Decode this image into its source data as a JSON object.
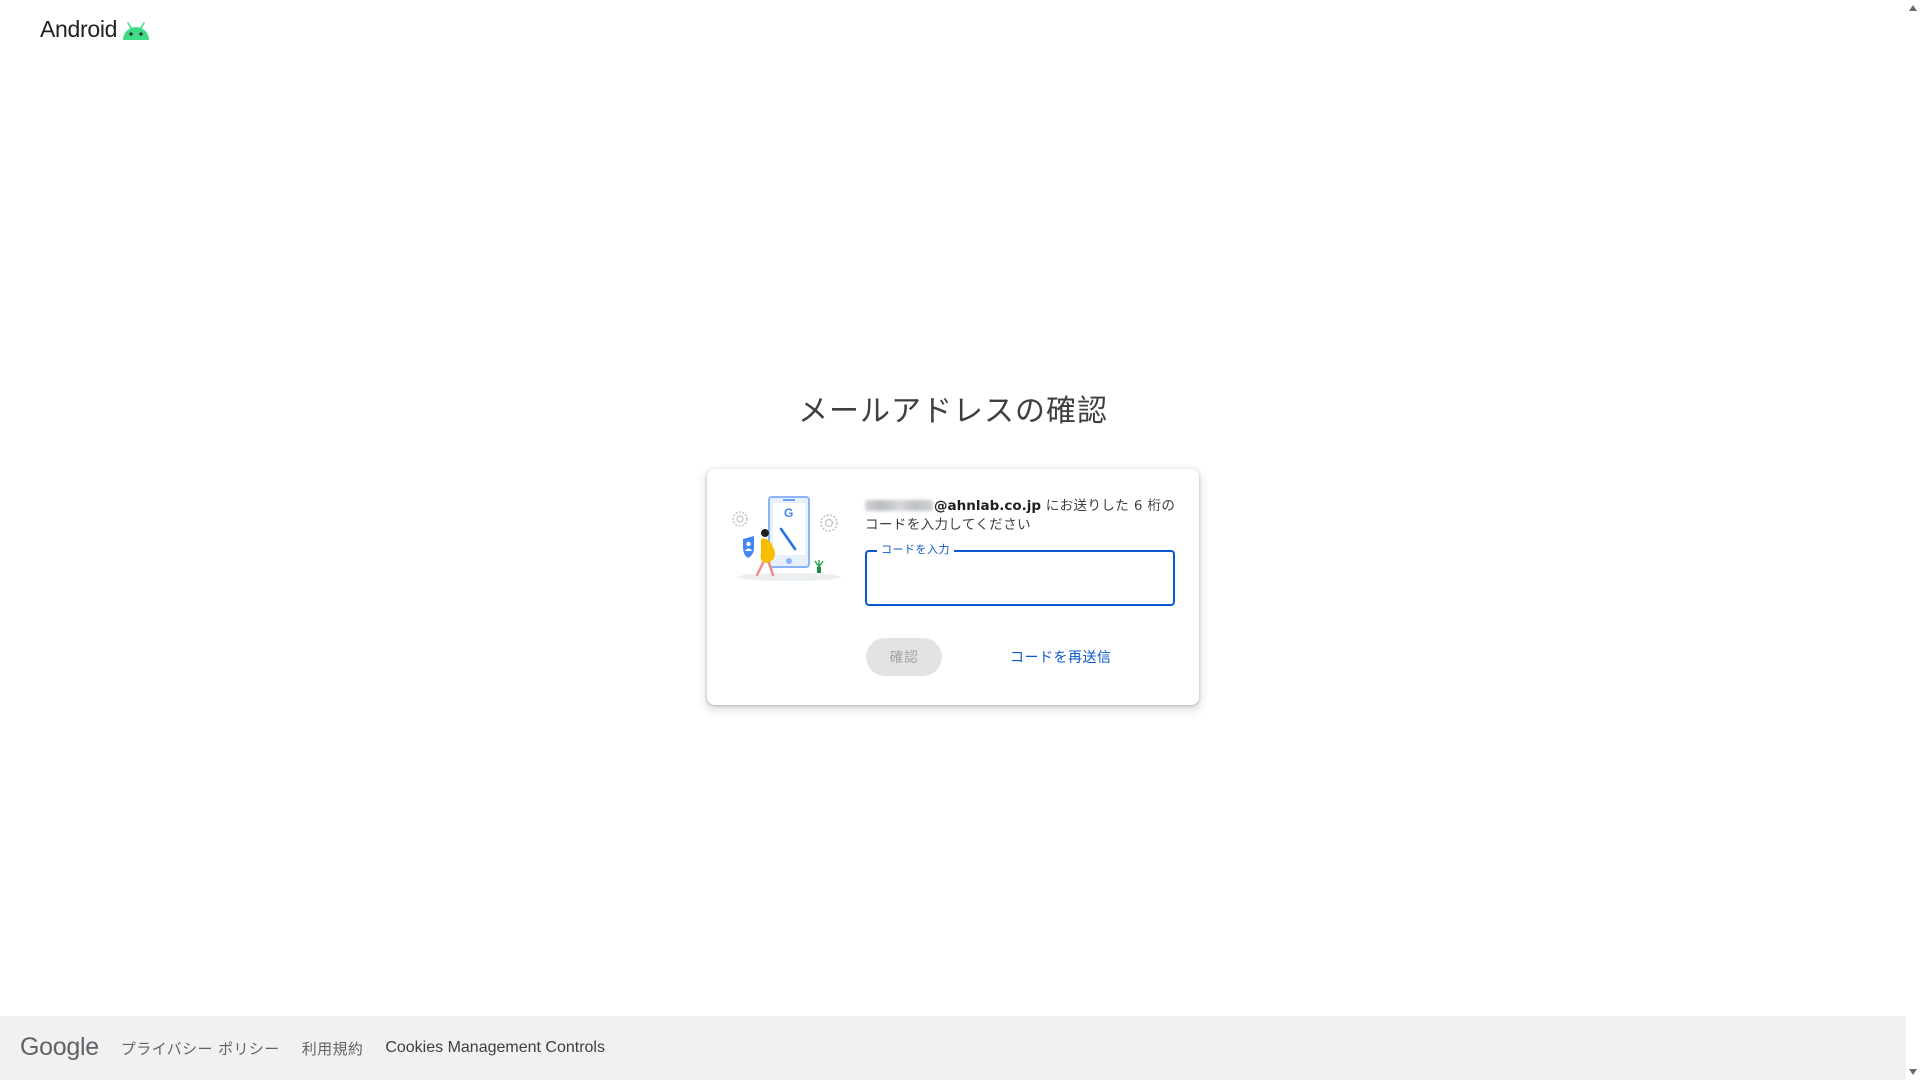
{
  "header": {
    "brand": "Android",
    "brand_icon": "android-bot-icon",
    "brand_icon_color": "#3ddc84"
  },
  "main": {
    "title": "メールアドレスの確認",
    "card": {
      "illustration": "phone-verification-illustration",
      "message_prefix_masked": true,
      "email_domain": "@ahnlab.co.jp",
      "message_text": " にお送りした 6 桁のコードを入力してください",
      "code_field": {
        "label": "コードを入力",
        "value": ""
      },
      "verify_label": "確認",
      "verify_disabled": true,
      "resend_label": "コードを再送信"
    }
  },
  "footer": {
    "logo": "Google",
    "links": [
      "プライバシー ポリシー",
      "利用規約",
      "Cookies Management Controls"
    ]
  },
  "colors": {
    "accent": "#0b57d0",
    "footer_bg": "#f1f1f1",
    "disabled_button_bg": "#e3e3e3"
  }
}
